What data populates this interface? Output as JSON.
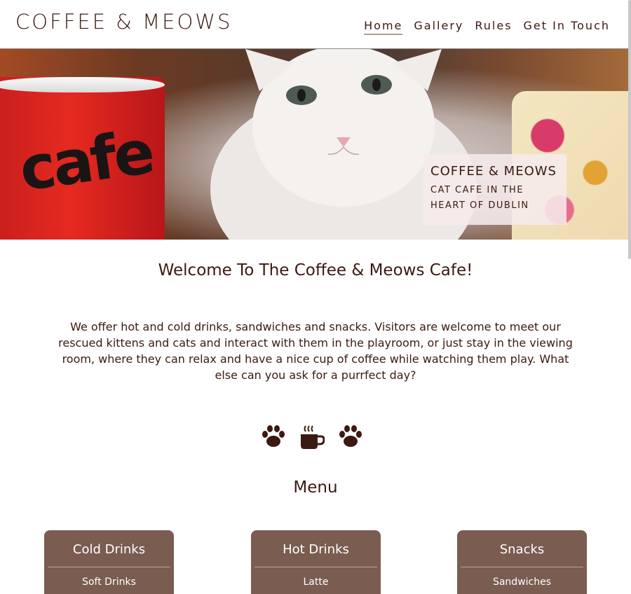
{
  "header": {
    "brand": "COFFEE & MEOWS",
    "nav": [
      {
        "label": "Home",
        "active": true
      },
      {
        "label": "Gallery",
        "active": false
      },
      {
        "label": "Rules",
        "active": false
      },
      {
        "label": "Get In Touch",
        "active": false
      }
    ]
  },
  "hero": {
    "mug_text": "cafe",
    "card_title": "COFFEE & MEOWS",
    "card_subtitle": "CAT CAFE IN THE HEART OF DUBLIN"
  },
  "welcome": {
    "title": "Welcome To The Coffee & Meows Cafe!",
    "text": "We offer hot and cold drinks, sandwiches and snacks. Visitors are welcome to meet our rescued kittens and cats and interact with them in the playroom, or just stay in the viewing room, where they can relax and have a nice cup of coffee while watching them play. What else can you ask for a purrfect day?"
  },
  "icons": [
    "paw-icon",
    "coffee-cup-icon",
    "paw-icon"
  ],
  "menu": {
    "title": "Menu",
    "cards": [
      {
        "title": "Cold Drinks",
        "first_item": "Soft Drinks"
      },
      {
        "title": "Hot Drinks",
        "first_item": "Latte"
      },
      {
        "title": "Snacks",
        "first_item": "Sandwiches"
      }
    ]
  },
  "colors": {
    "text": "#3b1a12",
    "card_bg": "#7a5c50",
    "nav_underline": "#b79a92"
  }
}
